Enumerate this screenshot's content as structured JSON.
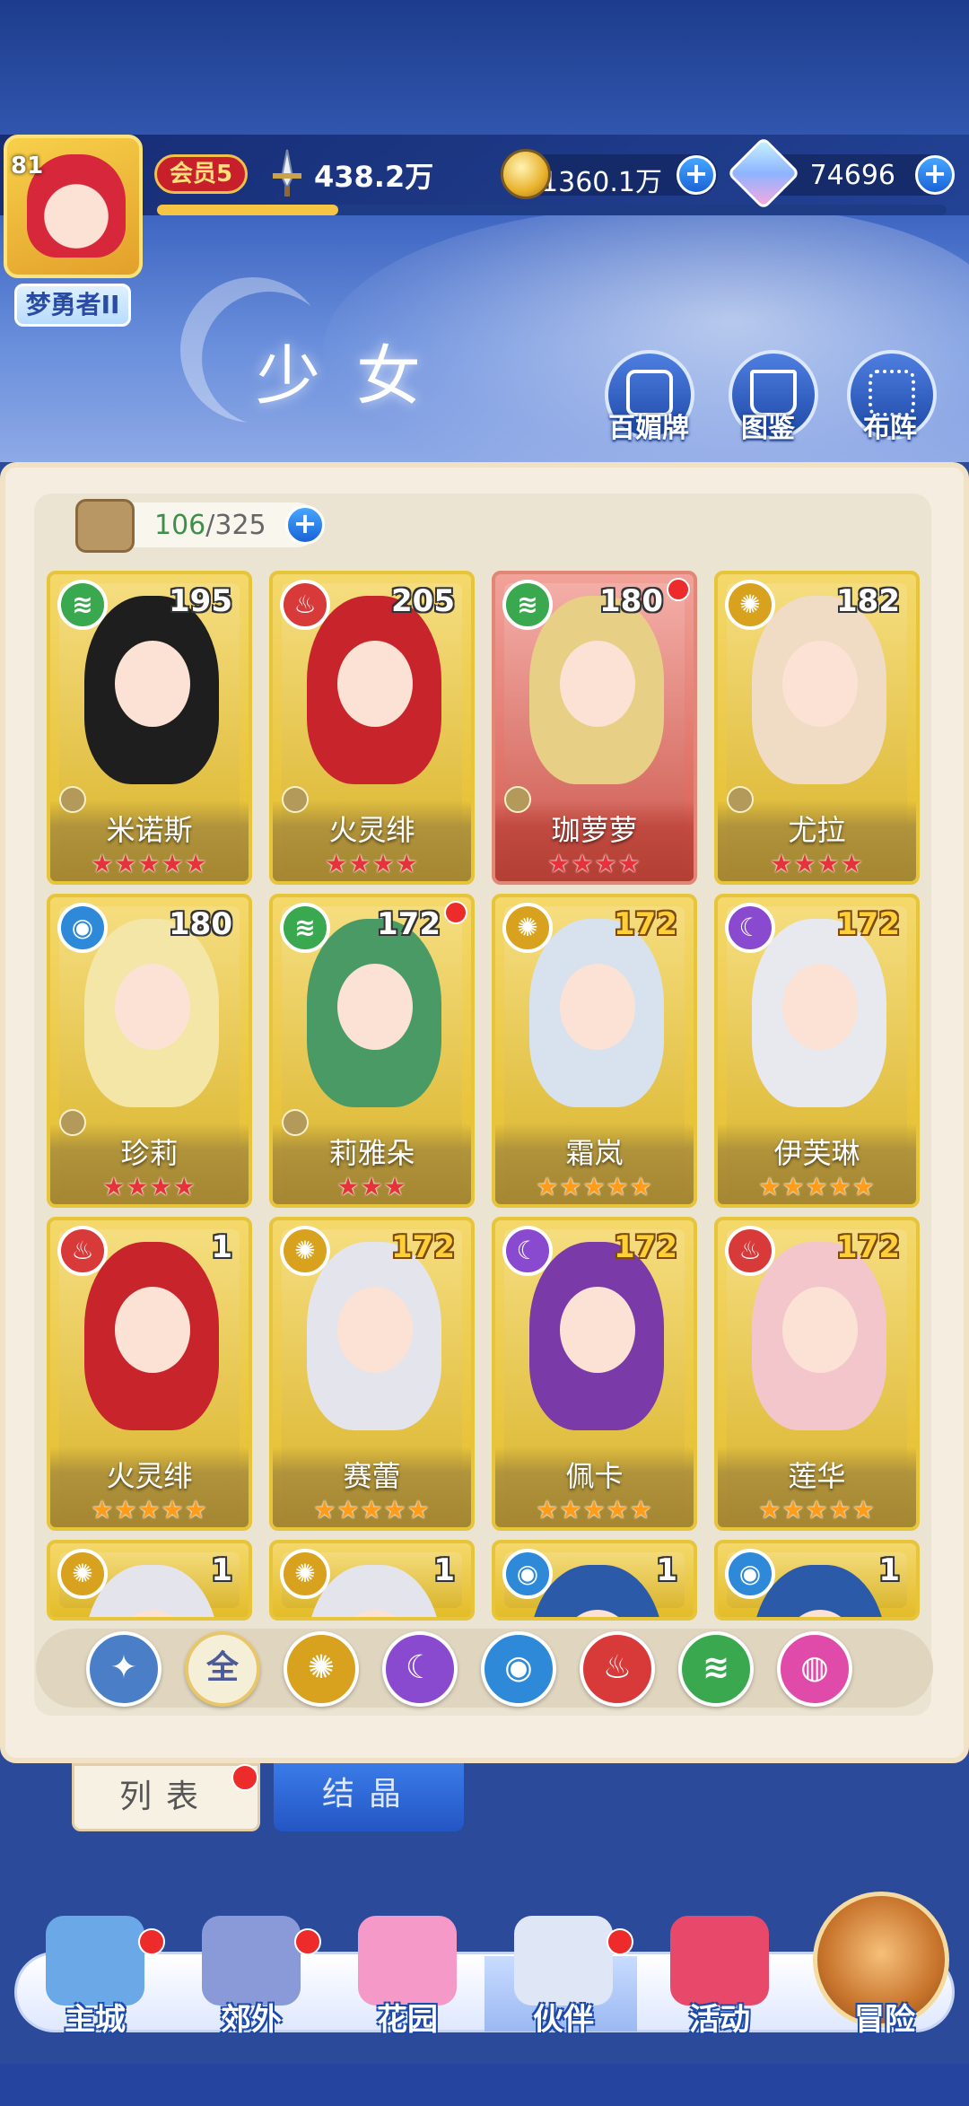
{
  "player": {
    "level": "81",
    "rank_title": "梦勇者II",
    "vip": "会员5",
    "power": "438.2万",
    "xp_progress": 0.23
  },
  "currency": {
    "gold": "1360.1万",
    "gems": "74696"
  },
  "page": {
    "title": "少女",
    "buttons": [
      "百媚牌",
      "图鉴",
      "布阵"
    ]
  },
  "roster": {
    "count": "106",
    "max": "325",
    "cards": [
      {
        "name": "米诺斯",
        "level": "195",
        "element": "wind",
        "stars": 5,
        "star_color": "red",
        "frame": "gold",
        "red_dot": false,
        "level_color": "white"
      },
      {
        "name": "火灵绯",
        "level": "205",
        "element": "fire",
        "stars": 4,
        "star_color": "red",
        "frame": "gold",
        "red_dot": false,
        "level_color": "white"
      },
      {
        "name": "珈萝萝",
        "level": "180",
        "element": "wind",
        "stars": 4,
        "star_color": "red",
        "frame": "red",
        "red_dot": true,
        "level_color": "white"
      },
      {
        "name": "尤拉",
        "level": "182",
        "element": "light",
        "stars": 4,
        "star_color": "red",
        "frame": "gold",
        "red_dot": false,
        "level_color": "white"
      },
      {
        "name": "珍莉",
        "level": "180",
        "element": "water",
        "stars": 4,
        "star_color": "red",
        "frame": "gold",
        "red_dot": false,
        "level_color": "white"
      },
      {
        "name": "莉雅朵",
        "level": "172",
        "element": "wind",
        "stars": 3,
        "star_color": "red",
        "frame": "gold",
        "red_dot": true,
        "level_color": "white"
      },
      {
        "name": "霜岚",
        "level": "172",
        "element": "light",
        "stars": 5,
        "star_color": "gold",
        "frame": "gold",
        "red_dot": false,
        "level_color": "gold"
      },
      {
        "name": "伊芙琳",
        "level": "172",
        "element": "dark",
        "stars": 5,
        "star_color": "gold",
        "frame": "gold",
        "red_dot": false,
        "level_color": "gold"
      },
      {
        "name": "火灵绯",
        "level": "1",
        "element": "fire",
        "stars": 5,
        "star_color": "gold",
        "frame": "gold",
        "red_dot": false,
        "level_color": "white"
      },
      {
        "name": "赛蕾",
        "level": "172",
        "element": "light",
        "stars": 5,
        "star_color": "gold",
        "frame": "gold",
        "red_dot": false,
        "level_color": "gold"
      },
      {
        "name": "佩卡",
        "level": "172",
        "element": "dark",
        "stars": 5,
        "star_color": "gold",
        "frame": "gold",
        "red_dot": false,
        "level_color": "gold"
      },
      {
        "name": "莲华",
        "level": "172",
        "element": "fire",
        "stars": 5,
        "star_color": "gold",
        "frame": "gold",
        "red_dot": false,
        "level_color": "gold"
      },
      {
        "name": "",
        "level": "1",
        "element": "light",
        "stars": 0,
        "star_color": "gold",
        "frame": "gold",
        "red_dot": false,
        "level_color": "white"
      },
      {
        "name": "",
        "level": "1",
        "element": "light",
        "stars": 0,
        "star_color": "gold",
        "frame": "gold",
        "red_dot": false,
        "level_color": "white"
      },
      {
        "name": "",
        "level": "1",
        "element": "water",
        "stars": 0,
        "star_color": "gold",
        "frame": "gold",
        "red_dot": false,
        "level_color": "white"
      },
      {
        "name": "",
        "level": "1",
        "element": "water",
        "stars": 0,
        "star_color": "gold",
        "frame": "gold",
        "red_dot": false,
        "level_color": "white"
      }
    ]
  },
  "filters": [
    {
      "key": "sort",
      "label": ""
    },
    {
      "key": "all",
      "label": "全"
    },
    {
      "key": "light",
      "label": ""
    },
    {
      "key": "dark",
      "label": ""
    },
    {
      "key": "water",
      "label": ""
    },
    {
      "key": "fire",
      "label": ""
    },
    {
      "key": "wind",
      "label": ""
    },
    {
      "key": "special",
      "label": ""
    }
  ],
  "tabs": {
    "list": "列表",
    "crystal": "结晶"
  },
  "nav": [
    {
      "label": "主城",
      "badge": true
    },
    {
      "label": "郊外",
      "badge": true
    },
    {
      "label": "花园",
      "badge": false
    },
    {
      "label": "伙伴",
      "badge": true
    },
    {
      "label": "活动",
      "badge": false
    },
    {
      "label": "冒险",
      "badge": false
    }
  ],
  "colors": {
    "fire": "#d83a3a",
    "wind": "#3aa84e",
    "water": "#2e8ad8",
    "light": "#d9a21e",
    "dark": "#8a4ad0",
    "special": "#e04aa8",
    "sort": "#4a7fc8",
    "all": "#f6efd8"
  }
}
